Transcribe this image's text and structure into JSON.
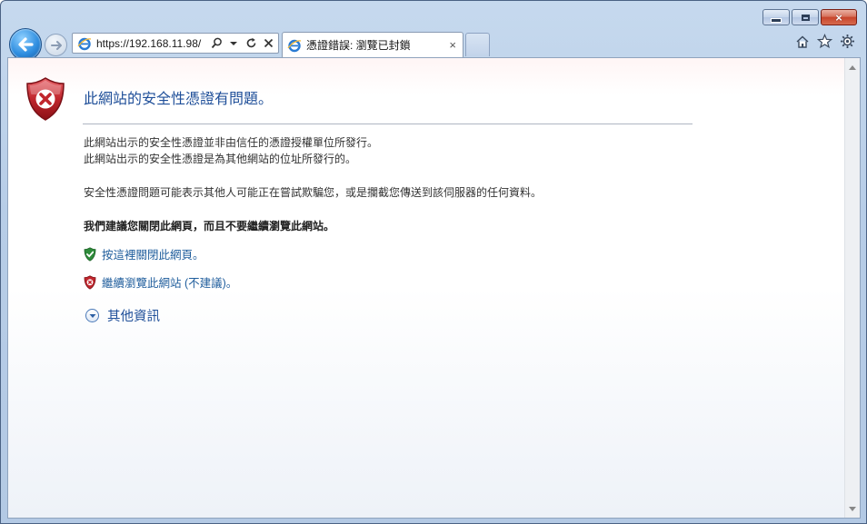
{
  "browser": {
    "address": "https://192.168.11.98/",
    "tab_title": "憑證錯誤: 瀏覽已封鎖",
    "caption": {
      "minimize": "minimize-icon",
      "maximize": "maximize-icon",
      "close": "×"
    },
    "toolbar_icons": [
      "home-icon",
      "star-icon",
      "gear-icon"
    ],
    "tab_close": "×"
  },
  "page": {
    "heading": "此網站的安全性憑證有問題。",
    "line1": "此網站出示的安全性憑證並非由信任的憑證授權單位所發行。",
    "line2": "此網站出示的安全性憑證是為其他網站的位址所發行的。",
    "line3": "安全性憑證問題可能表示其他人可能正在嘗試欺騙您，或是攔截您傳送到該伺服器的任何資料。",
    "recommend": "我們建議您關閉此網頁，而且不要繼續瀏覽此網站。",
    "close_link": "按這裡關閉此網頁。",
    "continue_link": "繼續瀏覽此網站 (不建議)。",
    "more_info": "其他資訊"
  },
  "colors": {
    "heading": "#1f4f99",
    "link": "#1f5d9c",
    "error_shield": "#c0262d",
    "safe_shield": "#2e8b3a"
  }
}
